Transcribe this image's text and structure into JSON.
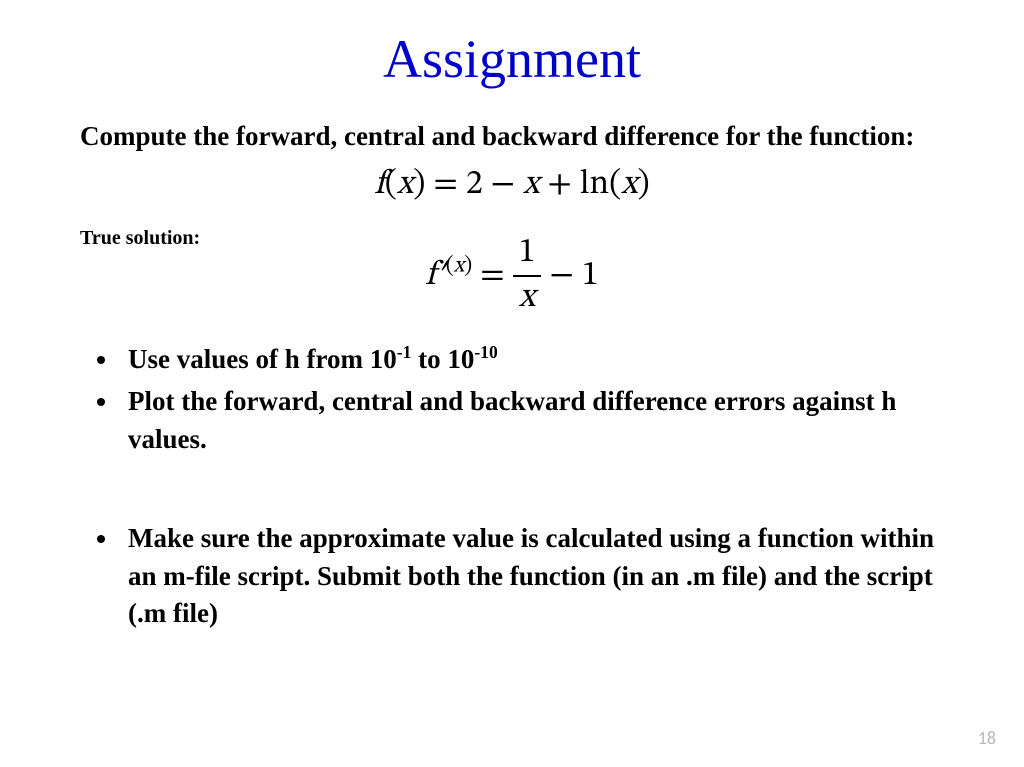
{
  "title": "Assignment",
  "intro": "Compute the forward, central and backward difference for the function:",
  "equation1": {
    "lhs_f": "f",
    "lhs_x": "x",
    "eq": " = ",
    "r1": "2 ",
    "minus1": " − ",
    "r2": "x",
    "plus": " + ",
    "ln": "ln(",
    "r3": "x",
    "close": ")"
  },
  "true_label": "True solution:",
  "equation2": {
    "lhs_f": "f",
    "prime": "′",
    "sup_open": "(",
    "sup_x": "x",
    "sup_close": ")",
    "eq": " = ",
    "num": "1",
    "den": "x",
    "minus": " − ",
    "one": "1"
  },
  "bullets": {
    "b1_a": "Use values of h from 10",
    "b1_s1": "-1",
    "b1_b": " to 10",
    "b1_s2": "-10",
    "b2": "Plot the forward, central and backward difference errors against h values.",
    "b3": "Make sure the approximate value is calculated using a function within an m-file script. Submit both the function (in an .m file) and the script (.m file)"
  },
  "page_number": "18"
}
